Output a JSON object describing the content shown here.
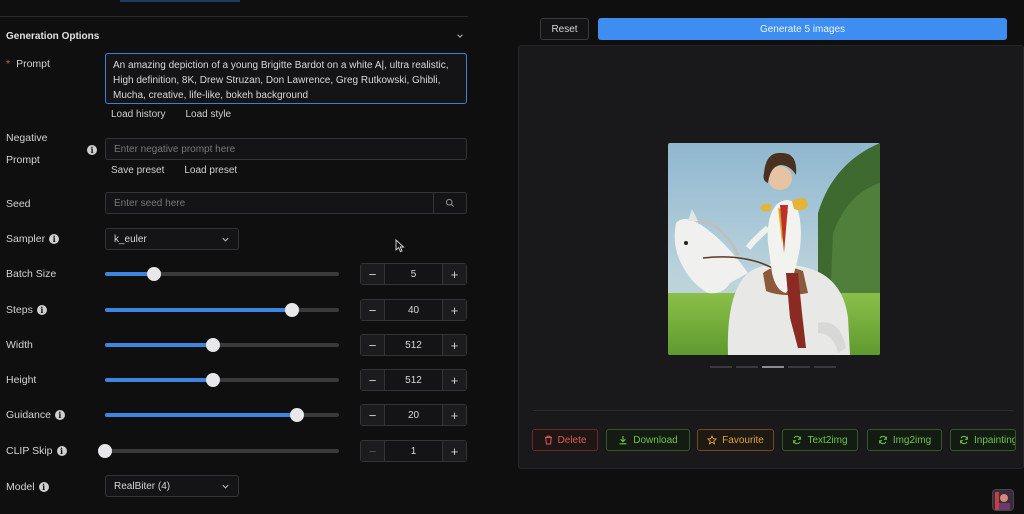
{
  "section": {
    "title": "Generation Options"
  },
  "prompt": {
    "label": "Prompt",
    "required_mark": "*",
    "value": "An amazing depiction of a young Brigitte Bardot on a white A|, ultra realistic, High definition, 8K, Drew Struzan, Don Lawrence, Greg Rutkowski, Ghibli, Mucha, creative, life-like, bokeh background",
    "links": [
      "Load history",
      "Load style"
    ]
  },
  "negative_prompt": {
    "label_line1": "Negative",
    "label_line2": "Prompt",
    "placeholder": "Enter negative prompt here",
    "links": [
      "Save preset",
      "Load preset"
    ]
  },
  "seed": {
    "label": "Seed",
    "placeholder": "Enter seed here"
  },
  "sampler": {
    "label": "Sampler",
    "value": "k_euler"
  },
  "sliders": [
    {
      "label": "Batch Size",
      "value": "5",
      "fraction": 0.21,
      "info": false
    },
    {
      "label": "Steps",
      "value": "40",
      "fraction": 0.8,
      "info": true
    },
    {
      "label": "Width",
      "value": "512",
      "fraction": 0.46,
      "info": false
    },
    {
      "label": "Height",
      "value": "512",
      "fraction": 0.46,
      "info": false
    },
    {
      "label": "Guidance",
      "value": "20",
      "fraction": 0.82,
      "info": true
    },
    {
      "label": "CLIP Skip",
      "value": "1",
      "fraction": 0.0,
      "info": true
    }
  ],
  "model": {
    "label": "Model",
    "value": "RealBiter (4)"
  },
  "buttons": {
    "reset": "Reset",
    "generate": "Generate 5 images"
  },
  "actions": [
    "Delete",
    "Download",
    "Favourite",
    "Text2img",
    "Img2img",
    "Inpainting"
  ],
  "colors": {
    "accent": "#3d8ef0",
    "delete": "#e05a4f",
    "green": "#6cc54a",
    "favourite": "#e0a13a"
  }
}
